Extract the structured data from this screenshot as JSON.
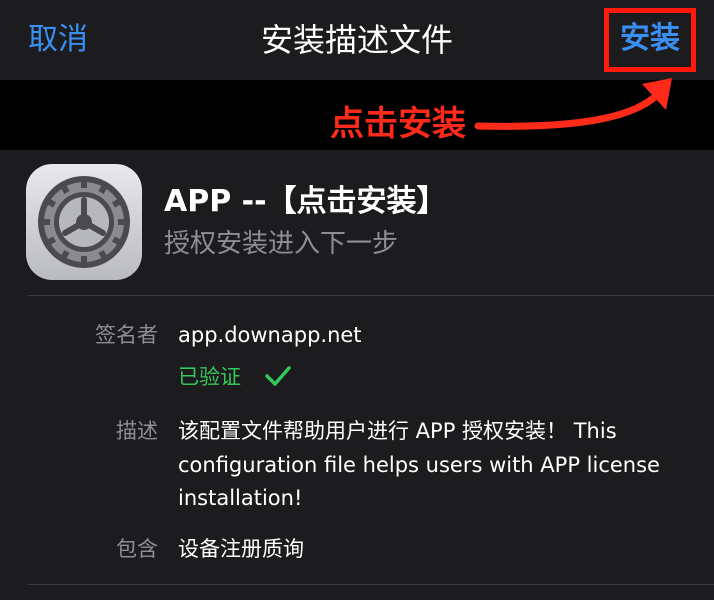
{
  "navbar": {
    "cancel_label": "取消",
    "title": "安装描述文件",
    "install_label": "安装"
  },
  "annotation": {
    "text": "点击安装",
    "color": "#ff2a1a"
  },
  "profile": {
    "app_name": "APP --【点击安装】",
    "subtitle": "授权安装进入下一步",
    "icon": "settings-gear-icon"
  },
  "details": {
    "signer_label": "签名者",
    "signer_value": "app.downapp.net",
    "verified_label": "已验证",
    "description_label": "描述",
    "description_lines": [
      "该配置文件帮助用户进行 APP 授权安装！ This",
      "configuration file helps users with APP license",
      "installation!"
    ],
    "contains_label": "包含",
    "contains_value": "设备注册质询"
  },
  "colors": {
    "accent": "#3a8ff5",
    "verified": "#34c759",
    "highlight_border": "#ff1a0e",
    "background": "#1c1c1e"
  }
}
